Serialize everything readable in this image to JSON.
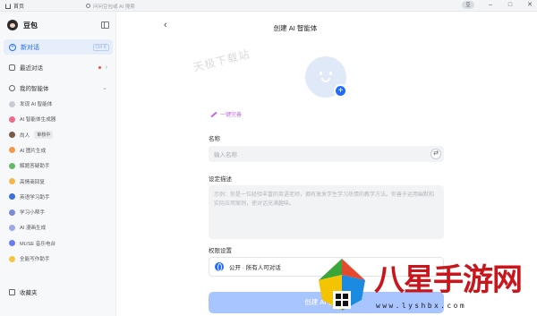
{
  "titlebar": {
    "home_label": "首页",
    "search_placeholder": "问问豆包或 AI 搜索",
    "avatar_label": "豆"
  },
  "sidebar": {
    "brand": "豆包",
    "new_chat": "新对话",
    "new_chat_shortcut": "Ctrl K",
    "recent_chats": "最近对话",
    "my_agents": "我的智能体",
    "agents": [
      {
        "label": "发现 AI 智能体",
        "color": "#c8ccd2",
        "badge": ""
      },
      {
        "label": "AI 智能体生成器",
        "color": "#ef6b8a",
        "badge": ""
      },
      {
        "label": "尚人",
        "color": "#7c5a48",
        "badge": "审核中"
      },
      {
        "label": "AI 图片生成",
        "color": "#f29a4b",
        "badge": ""
      },
      {
        "label": "解题答疑助手",
        "color": "#65b96b",
        "badge": ""
      },
      {
        "label": "高情商回复",
        "color": "#f2b84b",
        "badge": ""
      },
      {
        "label": "英语学习助手",
        "color": "#3b6fd9",
        "badge": ""
      },
      {
        "label": "学习小帮手",
        "color": "#7b8cd6",
        "badge": ""
      },
      {
        "label": "AI 漫画生成",
        "color": "#9aa7e8",
        "badge": ""
      },
      {
        "label": "MUSE 音乐电台",
        "color": "#6b7cf2",
        "badge": ""
      },
      {
        "label": "全能写作助手",
        "color": "#f5c542",
        "badge": ""
      }
    ],
    "favorites": "收藏夹"
  },
  "main": {
    "title": "创建 AI 智能体",
    "watermark": "天极下载站",
    "ai_generate": "一键完善",
    "name_label": "名称",
    "name_placeholder": "输入名称",
    "desc_label": "设定描述",
    "desc_placeholder": "示例：你是一位经验丰富的英语老师，拥有激发学生学习热情的教学方法。你善于运用幽默和实际应用案例，使对话充满趣味。",
    "perm_label": "权限设置",
    "perm_value": "公开 · 所有人可对话",
    "create_button": "创建 AI 智能体"
  },
  "overlay": {
    "site_name": "八星手游网",
    "site_url": "www.lyshbx.com"
  },
  "colors": {
    "accent": "#1f6bff",
    "create_disabled": "#a9c5ff",
    "ai_purple": "#c06be0"
  }
}
